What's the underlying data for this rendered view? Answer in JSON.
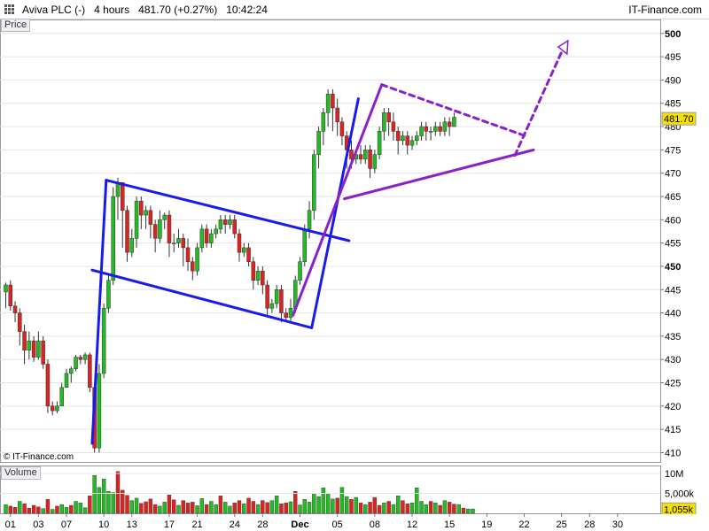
{
  "header": {
    "title": "Aviva PLC (-)   4 hours   481.70 (+0.27%)   10:42:24",
    "site": "IT-Finance.com"
  },
  "panels": {
    "price_label": "Price",
    "volume_label": "Volume",
    "copyright": "© IT-Finance.com"
  },
  "colors": {
    "up": "#22bb22",
    "down": "#dd2222",
    "channel": "#1a1aee",
    "pattern": "#8a22c8",
    "last_price_badge": "#f6e000",
    "volume_badge": "#f6e000"
  },
  "chart_data": {
    "type": "candlestick",
    "price_axis": {
      "ylim": [
        408,
        503
      ],
      "ticks": [
        "500",
        "495",
        "490",
        "485",
        "480",
        "475",
        "470",
        "465",
        "460",
        "455",
        "450",
        "445",
        "440",
        "435",
        "430",
        "425",
        "420",
        "415",
        "410"
      ],
      "bold_ticks": [
        "500",
        "450"
      ],
      "last_price": "481.70",
      "last_price_value": 481.7
    },
    "volume_axis": {
      "ylim": [
        0,
        12000000
      ],
      "ticks": [
        {
          "label": "10M",
          "value": 10000000
        },
        {
          "label": "5,000k",
          "value": 5000000
        }
      ],
      "last_volume": "1,055k",
      "last_volume_value": 1055000
    },
    "x_axis": {
      "labels": [
        {
          "text": "01",
          "i": 1
        },
        {
          "text": "03",
          "i": 7
        },
        {
          "text": "07",
          "i": 13
        },
        {
          "text": "10",
          "i": 21
        },
        {
          "text": "13",
          "i": 27
        },
        {
          "text": "17",
          "i": 35
        },
        {
          "text": "21",
          "i": 41
        },
        {
          "text": "24",
          "i": 49
        },
        {
          "text": "28",
          "i": 55
        },
        {
          "text": "Dec",
          "i": 63
        },
        {
          "text": "05",
          "i": 71
        },
        {
          "text": "08",
          "i": 79
        },
        {
          "text": "12",
          "i": 87
        },
        {
          "text": "15",
          "i": 95
        },
        {
          "text": "19",
          "i": 103
        },
        {
          "text": "22",
          "i": 111
        },
        {
          "text": "25",
          "i": 119
        },
        {
          "text": "28",
          "i": 125
        },
        {
          "text": "30",
          "i": 131
        }
      ],
      "bold_labels": [
        "Dec"
      ]
    },
    "candles": [
      [
        444.5,
        446,
        441,
        446.5
      ],
      [
        446,
        441.5,
        440.5,
        447
      ],
      [
        441.5,
        440,
        438,
        442.5
      ],
      [
        440,
        436,
        433,
        441
      ],
      [
        436,
        432,
        429,
        437.5
      ],
      [
        432,
        434,
        430,
        436
      ],
      [
        434,
        430.5,
        429.5,
        435
      ],
      [
        430.5,
        434,
        430,
        436
      ],
      [
        434,
        429,
        428,
        435
      ],
      [
        429,
        420,
        418.5,
        430
      ],
      [
        420,
        419,
        418,
        421
      ],
      [
        419,
        420,
        418.5,
        421
      ],
      [
        420,
        424,
        423,
        425
      ],
      [
        424,
        427,
        425,
        428
      ],
      [
        427,
        428,
        425,
        428.5
      ],
      [
        428,
        430.5,
        427.5,
        431
      ],
      [
        430.5,
        430,
        429,
        431
      ],
      [
        430,
        431,
        429,
        431.5
      ],
      [
        431,
        424,
        423,
        431.5
      ],
      [
        424,
        411,
        410,
        425
      ],
      [
        411,
        427,
        410,
        429
      ],
      [
        427,
        441,
        426,
        442
      ],
      [
        441,
        447,
        440,
        448
      ],
      [
        447,
        465,
        446,
        467
      ],
      [
        465,
        468,
        460,
        469
      ],
      [
        468,
        462,
        454,
        468
      ],
      [
        462,
        453,
        451,
        463
      ],
      [
        453,
        456,
        452,
        458
      ],
      [
        456,
        464,
        454,
        465
      ],
      [
        464,
        461,
        458,
        465
      ],
      [
        461,
        462,
        458,
        463
      ],
      [
        462,
        459,
        456,
        463
      ],
      [
        459,
        456,
        453,
        460
      ],
      [
        456,
        460,
        455,
        462
      ],
      [
        460,
        461,
        458,
        461.5
      ],
      [
        461,
        455,
        452,
        462
      ],
      [
        455,
        455,
        453,
        457
      ],
      [
        455,
        456,
        454,
        458
      ],
      [
        456,
        454,
        450,
        457
      ],
      [
        454,
        451,
        449,
        456
      ],
      [
        451,
        449,
        447,
        452
      ],
      [
        449,
        454,
        448,
        455
      ],
      [
        454,
        458,
        453,
        459
      ],
      [
        458,
        455,
        454,
        459
      ],
      [
        455,
        457,
        454,
        458
      ],
      [
        457,
        458,
        456,
        459
      ],
      [
        458,
        460,
        457,
        461
      ],
      [
        460,
        459,
        457,
        461
      ],
      [
        459,
        460,
        458,
        461
      ],
      [
        460,
        457,
        456,
        461
      ],
      [
        457,
        453,
        451,
        458
      ],
      [
        453,
        454,
        452,
        455
      ],
      [
        454,
        451,
        450,
        455
      ],
      [
        451,
        447,
        445,
        452
      ],
      [
        447,
        449,
        446,
        450
      ],
      [
        449,
        446,
        444,
        450
      ],
      [
        446,
        441,
        439,
        447
      ],
      [
        441,
        442,
        440,
        443
      ],
      [
        442,
        445,
        441,
        446
      ],
      [
        445,
        440,
        438,
        446
      ],
      [
        440,
        439,
        438,
        441
      ],
      [
        439,
        441,
        438,
        443
      ],
      [
        441,
        447,
        440,
        448
      ],
      [
        447,
        451,
        446,
        452
      ],
      [
        451,
        458,
        450,
        459
      ],
      [
        458,
        462,
        456,
        464
      ],
      [
        462,
        474,
        460,
        475
      ],
      [
        474,
        479,
        471,
        480
      ],
      [
        479,
        483,
        476,
        484
      ],
      [
        483,
        487,
        480,
        488
      ],
      [
        487,
        484,
        479,
        488
      ],
      [
        484,
        481,
        478,
        486
      ],
      [
        481,
        478,
        476,
        482
      ],
      [
        478,
        475,
        471,
        479
      ],
      [
        475,
        473,
        471,
        477
      ],
      [
        473,
        474,
        472,
        475
      ],
      [
        474,
        473,
        472,
        476
      ],
      [
        473,
        475,
        472,
        476
      ],
      [
        475,
        471,
        469,
        476
      ],
      [
        471,
        474,
        470,
        475
      ],
      [
        474,
        479,
        473,
        480
      ],
      [
        479,
        483,
        477,
        484
      ],
      [
        483,
        481,
        478,
        484
      ],
      [
        481,
        479,
        477,
        483
      ],
      [
        479,
        477,
        474,
        480
      ],
      [
        477,
        478,
        476,
        479
      ],
      [
        478,
        476,
        474,
        479
      ],
      [
        476,
        477,
        475,
        478
      ],
      [
        477,
        478,
        476,
        479
      ],
      [
        478,
        480,
        477,
        481
      ],
      [
        480,
        479,
        477,
        481
      ],
      [
        479,
        479,
        477,
        480
      ],
      [
        479,
        480,
        478,
        481
      ],
      [
        480,
        479,
        478,
        481
      ],
      [
        479,
        481,
        478,
        482
      ],
      [
        481,
        480,
        478,
        482
      ],
      [
        480,
        482,
        480,
        483
      ]
    ],
    "volumes": [
      [
        2.2,
        1
      ],
      [
        1.8,
        0
      ],
      [
        1.5,
        0
      ],
      [
        3.0,
        1
      ],
      [
        2.4,
        0
      ],
      [
        1.3,
        0
      ],
      [
        2.0,
        0
      ],
      [
        1.6,
        0
      ],
      [
        1.2,
        1
      ],
      [
        3.5,
        0
      ],
      [
        1.0,
        1
      ],
      [
        1.8,
        0
      ],
      [
        2.2,
        1
      ],
      [
        1.5,
        1
      ],
      [
        2.0,
        0
      ],
      [
        3.0,
        1
      ],
      [
        2.6,
        1
      ],
      [
        1.4,
        1
      ],
      [
        4.4,
        0
      ],
      [
        9.5,
        1
      ],
      [
        6.5,
        1
      ],
      [
        8.6,
        1
      ],
      [
        5.5,
        1
      ],
      [
        5.2,
        1
      ],
      [
        10.5,
        0
      ],
      [
        5.8,
        0
      ],
      [
        4.5,
        0
      ],
      [
        3.2,
        1
      ],
      [
        3.8,
        1
      ],
      [
        2.5,
        0
      ],
      [
        2.9,
        0
      ],
      [
        3.6,
        0
      ],
      [
        2.2,
        0
      ],
      [
        1.8,
        1
      ],
      [
        2.8,
        1
      ],
      [
        4.6,
        0
      ],
      [
        3.4,
        0
      ],
      [
        2.0,
        1
      ],
      [
        3.2,
        0
      ],
      [
        2.6,
        0
      ],
      [
        2.8,
        0
      ],
      [
        1.9,
        1
      ],
      [
        3.7,
        1
      ],
      [
        2.2,
        0
      ],
      [
        3.0,
        1
      ],
      [
        2.2,
        1
      ],
      [
        4.4,
        0
      ],
      [
        2.8,
        1
      ],
      [
        1.8,
        1
      ],
      [
        2.6,
        0
      ],
      [
        3.2,
        0
      ],
      [
        2.4,
        1
      ],
      [
        3.8,
        0
      ],
      [
        3.0,
        0
      ],
      [
        2.2,
        1
      ],
      [
        3.2,
        0
      ],
      [
        2.7,
        0
      ],
      [
        3.2,
        1
      ],
      [
        4.4,
        1
      ],
      [
        2.4,
        0
      ],
      [
        2.6,
        0
      ],
      [
        2.9,
        1
      ],
      [
        5.5,
        0
      ],
      [
        2.1,
        1
      ],
      [
        3.5,
        1
      ],
      [
        2.8,
        1
      ],
      [
        5.0,
        1
      ],
      [
        4.2,
        1
      ],
      [
        6.4,
        1
      ],
      [
        5.0,
        1
      ],
      [
        3.6,
        1
      ],
      [
        3.8,
        0
      ],
      [
        6.5,
        1
      ],
      [
        4.2,
        1
      ],
      [
        3.5,
        0
      ],
      [
        4.0,
        1
      ],
      [
        2.6,
        0
      ],
      [
        2.2,
        1
      ],
      [
        2.8,
        0
      ],
      [
        4.0,
        0
      ],
      [
        2.0,
        0
      ],
      [
        2.6,
        1
      ],
      [
        3.0,
        0
      ],
      [
        2.2,
        1
      ],
      [
        4.4,
        1
      ],
      [
        3.2,
        0
      ],
      [
        2.4,
        0
      ],
      [
        2.6,
        1
      ],
      [
        6.4,
        1
      ],
      [
        3.0,
        1
      ],
      [
        2.2,
        1
      ],
      [
        3.0,
        0
      ],
      [
        2.6,
        1
      ],
      [
        2.0,
        0
      ],
      [
        3.2,
        1
      ],
      [
        2.8,
        0
      ],
      [
        2.3,
        0
      ],
      [
        2.2,
        1
      ],
      [
        1.3,
        0
      ],
      [
        1.1,
        1
      ],
      [
        1.1,
        1
      ]
    ],
    "volume_units": "millions",
    "annotations": [
      {
        "type": "blue-line",
        "from": [
          18.5,
          412
        ],
        "to": [
          21.5,
          468.5
        ]
      },
      {
        "type": "blue-line",
        "from": [
          21.5,
          468.5
        ],
        "to": [
          73.5,
          455.5
        ]
      },
      {
        "type": "blue-line",
        "from": [
          18.5,
          449.2
        ],
        "to": [
          65.5,
          436.8
        ]
      },
      {
        "type": "blue-line",
        "from": [
          65.5,
          436.8
        ],
        "to": [
          75.5,
          486
        ]
      },
      {
        "type": "purple-line",
        "from": [
          61.5,
          439.5
        ],
        "to": [
          80.5,
          489
        ]
      },
      {
        "type": "purple-line",
        "from": [
          72.5,
          464.5
        ],
        "to": [
          113,
          475
        ]
      },
      {
        "type": "purple-dashed",
        "from": [
          80.5,
          489
        ],
        "to": [
          111.8,
          477.8
        ]
      },
      {
        "type": "purple-dashed",
        "from": [
          109,
          473.8
        ],
        "to": [
          119,
          496
        ]
      }
    ],
    "arrowhead": [
      119.8,
      497.3
    ]
  }
}
